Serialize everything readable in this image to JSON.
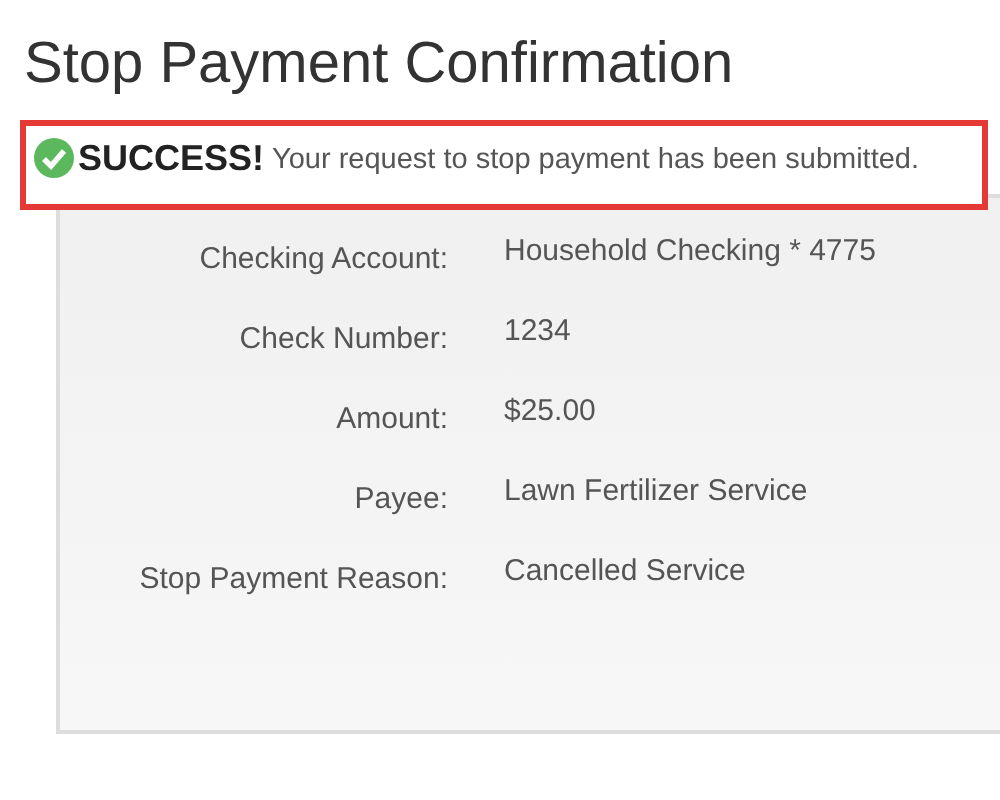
{
  "title": "Stop Payment Confirmation",
  "alert": {
    "kind": "success",
    "heading": "SUCCESS!",
    "message": "Your request to stop payment has been submitted."
  },
  "details": [
    {
      "label": "Checking Account:",
      "value": "Household Checking * 4775"
    },
    {
      "label": "Check Number:",
      "value": "1234"
    },
    {
      "label": "Amount:",
      "value": "$25.00"
    },
    {
      "label": "Payee:",
      "value": "Lawn Fertilizer Service"
    },
    {
      "label": "Stop Payment Reason:",
      "value": "Cancelled Service"
    }
  ]
}
